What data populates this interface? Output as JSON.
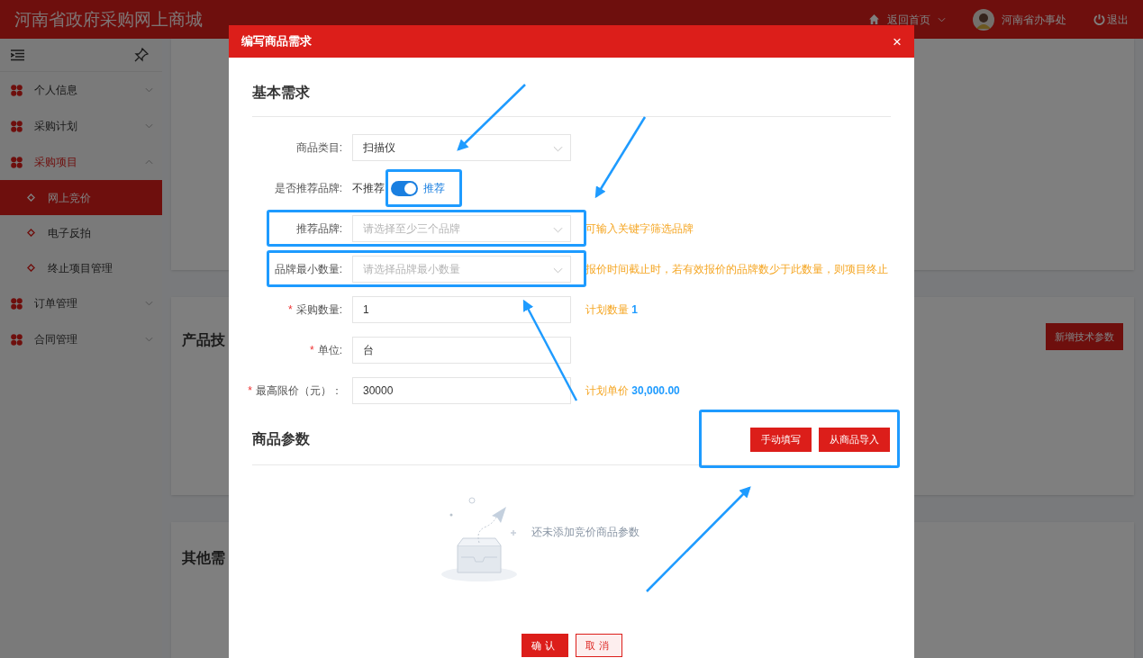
{
  "header": {
    "title": "河南省政府采购网上商城",
    "home_link": "返回首页",
    "user": "河南省办事处",
    "logout": "退出"
  },
  "sidebar": {
    "items": [
      {
        "label": "个人信息",
        "expanded": false,
        "selected": false
      },
      {
        "label": "采购计划",
        "expanded": false,
        "selected": false
      },
      {
        "label": "采购项目",
        "expanded": true,
        "selected": true,
        "children": [
          {
            "label": "网上竞价",
            "selected": true
          },
          {
            "label": "电子反拍",
            "selected": false
          },
          {
            "label": "终止项目管理",
            "selected": false
          }
        ]
      },
      {
        "label": "订单管理",
        "expanded": false,
        "selected": false
      },
      {
        "label": "合同管理",
        "expanded": false,
        "selected": false
      }
    ]
  },
  "background": {
    "cards": [
      {
        "title": "产品技",
        "button": "新增技术参数"
      },
      {
        "title": "其他需"
      }
    ]
  },
  "dialog": {
    "title": "编写商品需求",
    "close": "×",
    "basic": {
      "title": "基本需求",
      "required_mark": "*",
      "fields": [
        {
          "kind": "select",
          "label": "商品类目:",
          "required": false,
          "value": "扫描仪",
          "highlighted": false
        },
        {
          "kind": "switch",
          "label": "是否推荐品牌:",
          "required": false,
          "off_label": "不推荐",
          "on_label": "推荐",
          "on": true,
          "highlighted": true
        },
        {
          "kind": "select",
          "label": "推荐品牌:",
          "required": false,
          "placeholder": "请选择至少三个品牌",
          "hint": "可输入关键字筛选品牌",
          "highlighted": true
        },
        {
          "kind": "select",
          "label": "品牌最小数量:",
          "required": false,
          "placeholder": "请选择品牌最小数量",
          "hint": "报价时间截止时，若有效报价的品牌数少于此数量，则项目终止",
          "highlighted": true
        },
        {
          "kind": "input",
          "label": "采购数量:",
          "required": true,
          "value": "1",
          "hint": "计划数量",
          "hint_value": "1",
          "highlighted": false
        },
        {
          "kind": "input",
          "label": "单位:",
          "required": true,
          "value": "台",
          "highlighted": false
        },
        {
          "kind": "input",
          "label": "最高限价（元）：",
          "required": true,
          "value": "30000",
          "hint": "计划单价",
          "hint_value": "30,000.00",
          "highlighted": false
        }
      ]
    },
    "params": {
      "title": "商品参数",
      "highlighted": true,
      "buttons": [
        "手动填写",
        "从商品导入"
      ],
      "empty_text": "还未添加竞价商品参数"
    },
    "footer": [
      {
        "label": "确认",
        "kind": "primary"
      },
      {
        "label": "取消",
        "kind": "secondary"
      }
    ]
  }
}
